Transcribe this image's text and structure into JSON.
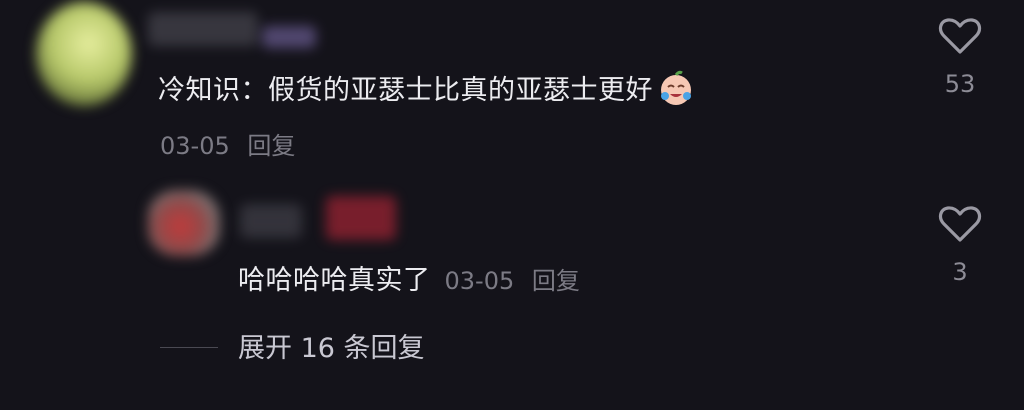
{
  "comment": {
    "text": "冷知识：假货的亚瑟士比真的亚瑟士更好",
    "emoji": "crying-laughing-face-icon",
    "date": "03-05",
    "reply_label": "回复",
    "like_count": "53"
  },
  "reply": {
    "text": "哈哈哈哈真实了",
    "date": "03-05",
    "reply_label": "回复",
    "like_count": "3"
  },
  "expand": {
    "label": "展开 16 条回复"
  },
  "colors": {
    "background": "#14131a",
    "primary_text": "#ececf0",
    "secondary_text": "#7c7b85"
  }
}
